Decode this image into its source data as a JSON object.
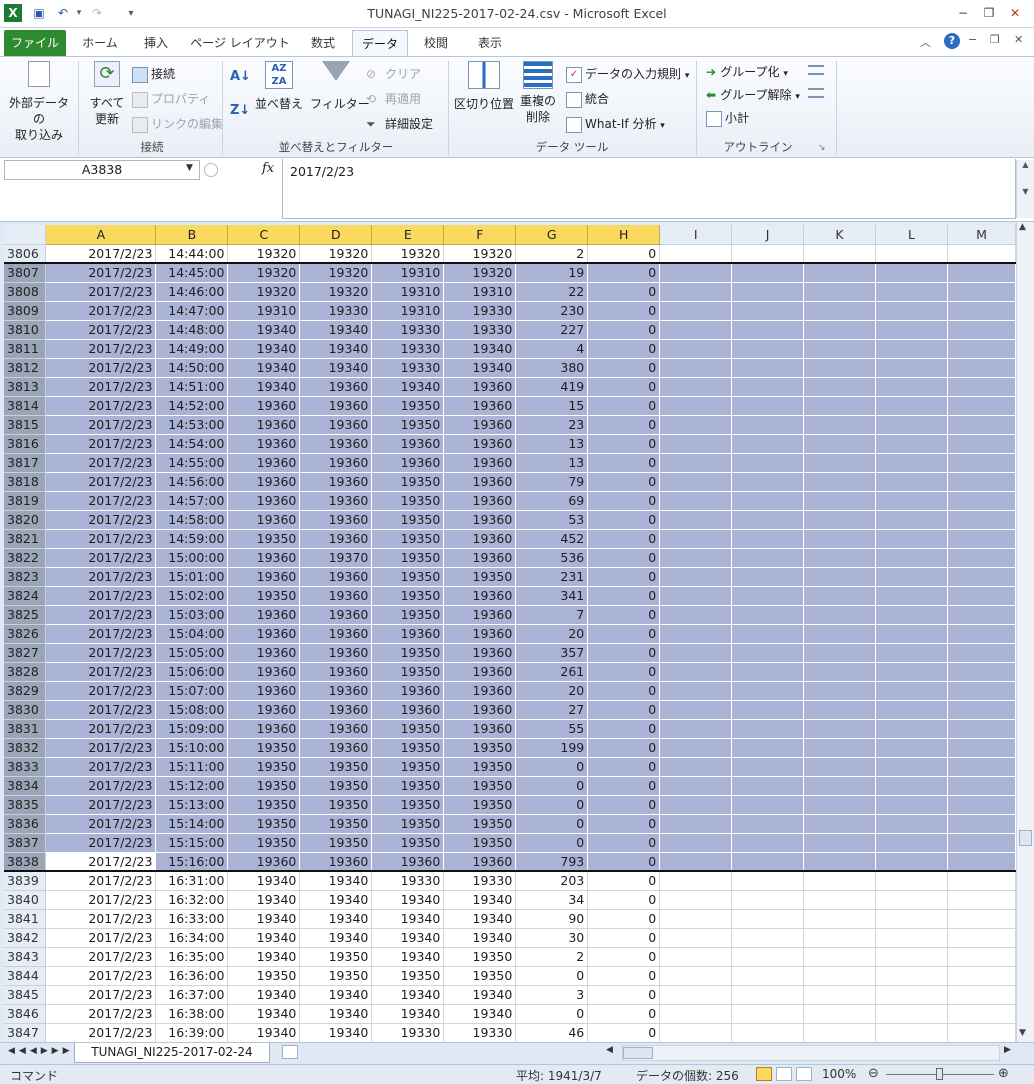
{
  "window": {
    "title": "TUNAGI_NI225-2017-02-24.csv - Microsoft Excel"
  },
  "tabs": [
    "ファイル",
    "ホーム",
    "挿入",
    "ページ レイアウト",
    "数式",
    "データ",
    "校閲",
    "表示"
  ],
  "ribbon": {
    "external": "外部データの\n取り込み",
    "refresh_all": "すべて\n更新",
    "connections": "接続",
    "properties": "プロパティ",
    "edit_links": "リンクの編集",
    "group_connections": "接続",
    "sort": "並べ替え",
    "filter": "フィルター",
    "clear": "クリア",
    "reapply": "再適用",
    "advanced": "詳細設定",
    "group_sortfilter": "並べ替えとフィルター",
    "text_to_columns": "区切り位置",
    "remove_duplicates": "重複の\n削除",
    "data_validation": "データの入力規則",
    "consolidate": "統合",
    "whatif": "What-If 分析",
    "group_datatools": "データ ツール",
    "group_btn": "グループ化",
    "ungroup_btn": "グループ解除",
    "subtotal": "小計",
    "group_outline": "アウトライン"
  },
  "formula_bar": {
    "name_box": "A3838",
    "fx": "fx",
    "value": "2017/2/23"
  },
  "columns": [
    "A",
    "B",
    "C",
    "D",
    "E",
    "F",
    "G",
    "H",
    "I",
    "J",
    "K",
    "L",
    "M"
  ],
  "rows": [
    [
      "3806",
      "2017/2/23",
      "14:44:00",
      "19320",
      "19320",
      "19320",
      "19320",
      "2",
      "0"
    ],
    [
      "3807",
      "2017/2/23",
      "14:45:00",
      "19320",
      "19320",
      "19310",
      "19320",
      "19",
      "0"
    ],
    [
      "3808",
      "2017/2/23",
      "14:46:00",
      "19320",
      "19320",
      "19310",
      "19310",
      "22",
      "0"
    ],
    [
      "3809",
      "2017/2/23",
      "14:47:00",
      "19310",
      "19330",
      "19310",
      "19330",
      "230",
      "0"
    ],
    [
      "3810",
      "2017/2/23",
      "14:48:00",
      "19340",
      "19340",
      "19330",
      "19330",
      "227",
      "0"
    ],
    [
      "3811",
      "2017/2/23",
      "14:49:00",
      "19340",
      "19340",
      "19330",
      "19340",
      "4",
      "0"
    ],
    [
      "3812",
      "2017/2/23",
      "14:50:00",
      "19340",
      "19340",
      "19330",
      "19340",
      "380",
      "0"
    ],
    [
      "3813",
      "2017/2/23",
      "14:51:00",
      "19340",
      "19360",
      "19340",
      "19360",
      "419",
      "0"
    ],
    [
      "3814",
      "2017/2/23",
      "14:52:00",
      "19360",
      "19360",
      "19350",
      "19360",
      "15",
      "0"
    ],
    [
      "3815",
      "2017/2/23",
      "14:53:00",
      "19360",
      "19360",
      "19350",
      "19360",
      "23",
      "0"
    ],
    [
      "3816",
      "2017/2/23",
      "14:54:00",
      "19360",
      "19360",
      "19360",
      "19360",
      "13",
      "0"
    ],
    [
      "3817",
      "2017/2/23",
      "14:55:00",
      "19360",
      "19360",
      "19360",
      "19360",
      "13",
      "0"
    ],
    [
      "3818",
      "2017/2/23",
      "14:56:00",
      "19360",
      "19360",
      "19350",
      "19360",
      "79",
      "0"
    ],
    [
      "3819",
      "2017/2/23",
      "14:57:00",
      "19360",
      "19360",
      "19350",
      "19360",
      "69",
      "0"
    ],
    [
      "3820",
      "2017/2/23",
      "14:58:00",
      "19360",
      "19360",
      "19350",
      "19360",
      "53",
      "0"
    ],
    [
      "3821",
      "2017/2/23",
      "14:59:00",
      "19350",
      "19360",
      "19350",
      "19360",
      "452",
      "0"
    ],
    [
      "3822",
      "2017/2/23",
      "15:00:00",
      "19360",
      "19370",
      "19350",
      "19360",
      "536",
      "0"
    ],
    [
      "3823",
      "2017/2/23",
      "15:01:00",
      "19360",
      "19360",
      "19350",
      "19350",
      "231",
      "0"
    ],
    [
      "3824",
      "2017/2/23",
      "15:02:00",
      "19350",
      "19360",
      "19350",
      "19360",
      "341",
      "0"
    ],
    [
      "3825",
      "2017/2/23",
      "15:03:00",
      "19360",
      "19360",
      "19350",
      "19360",
      "7",
      "0"
    ],
    [
      "3826",
      "2017/2/23",
      "15:04:00",
      "19360",
      "19360",
      "19360",
      "19360",
      "20",
      "0"
    ],
    [
      "3827",
      "2017/2/23",
      "15:05:00",
      "19360",
      "19360",
      "19350",
      "19360",
      "357",
      "0"
    ],
    [
      "3828",
      "2017/2/23",
      "15:06:00",
      "19360",
      "19360",
      "19350",
      "19360",
      "261",
      "0"
    ],
    [
      "3829",
      "2017/2/23",
      "15:07:00",
      "19360",
      "19360",
      "19360",
      "19360",
      "20",
      "0"
    ],
    [
      "3830",
      "2017/2/23",
      "15:08:00",
      "19360",
      "19360",
      "19360",
      "19360",
      "27",
      "0"
    ],
    [
      "3831",
      "2017/2/23",
      "15:09:00",
      "19360",
      "19360",
      "19350",
      "19360",
      "55",
      "0"
    ],
    [
      "3832",
      "2017/2/23",
      "15:10:00",
      "19350",
      "19360",
      "19350",
      "19350",
      "199",
      "0"
    ],
    [
      "3833",
      "2017/2/23",
      "15:11:00",
      "19350",
      "19350",
      "19350",
      "19350",
      "0",
      "0"
    ],
    [
      "3834",
      "2017/2/23",
      "15:12:00",
      "19350",
      "19350",
      "19350",
      "19350",
      "0",
      "0"
    ],
    [
      "3835",
      "2017/2/23",
      "15:13:00",
      "19350",
      "19350",
      "19350",
      "19350",
      "0",
      "0"
    ],
    [
      "3836",
      "2017/2/23",
      "15:14:00",
      "19350",
      "19350",
      "19350",
      "19350",
      "0",
      "0"
    ],
    [
      "3837",
      "2017/2/23",
      "15:15:00",
      "19350",
      "19350",
      "19350",
      "19350",
      "0",
      "0"
    ],
    [
      "3838",
      "2017/2/23",
      "15:16:00",
      "19360",
      "19360",
      "19360",
      "19360",
      "793",
      "0"
    ],
    [
      "3839",
      "2017/2/23",
      "16:31:00",
      "19340",
      "19340",
      "19330",
      "19330",
      "203",
      "0"
    ],
    [
      "3840",
      "2017/2/23",
      "16:32:00",
      "19340",
      "19340",
      "19340",
      "19340",
      "34",
      "0"
    ],
    [
      "3841",
      "2017/2/23",
      "16:33:00",
      "19340",
      "19340",
      "19340",
      "19340",
      "90",
      "0"
    ],
    [
      "3842",
      "2017/2/23",
      "16:34:00",
      "19340",
      "19340",
      "19340",
      "19340",
      "30",
      "0"
    ],
    [
      "3843",
      "2017/2/23",
      "16:35:00",
      "19340",
      "19350",
      "19340",
      "19350",
      "2",
      "0"
    ],
    [
      "3844",
      "2017/2/23",
      "16:36:00",
      "19350",
      "19350",
      "19350",
      "19350",
      "0",
      "0"
    ],
    [
      "3845",
      "2017/2/23",
      "16:37:00",
      "19340",
      "19340",
      "19340",
      "19340",
      "3",
      "0"
    ],
    [
      "3846",
      "2017/2/23",
      "16:38:00",
      "19340",
      "19340",
      "19340",
      "19340",
      "0",
      "0"
    ],
    [
      "3847",
      "2017/2/23",
      "16:39:00",
      "19340",
      "19340",
      "19330",
      "19330",
      "46",
      "0"
    ]
  ],
  "selection": {
    "first_row": "3807",
    "last_row": "3838",
    "active_row": "3838"
  },
  "sheet": {
    "tab": "TUNAGI_NI225-2017-02-24"
  },
  "status": {
    "mode": "コマンド",
    "average": "平均: 1941/3/7",
    "count": "データの個数: 256",
    "zoom": "100%"
  },
  "colors": {
    "selection": "#aab3d5",
    "file_tab": "#2f8b2f",
    "col_header_selected": "#f9d95e"
  }
}
